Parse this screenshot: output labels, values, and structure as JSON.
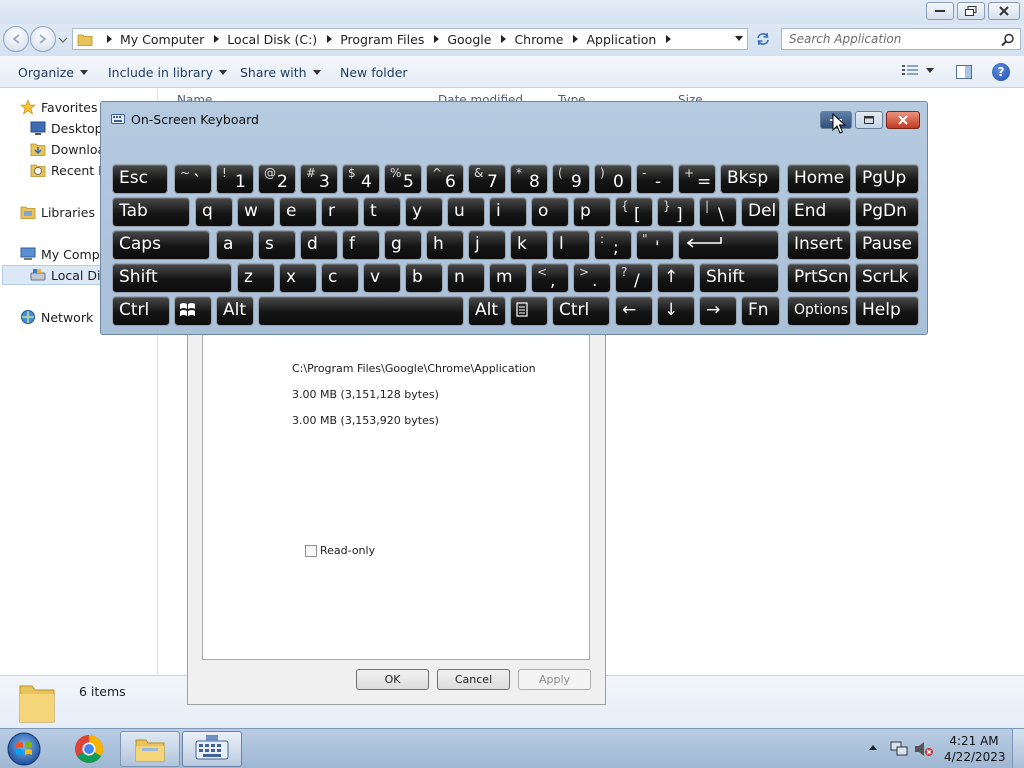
{
  "explorer": {
    "breadcrumb": [
      "My Computer",
      "Local Disk (C:)",
      "Program Files",
      "Google",
      "Chrome",
      "Application"
    ],
    "search_placeholder": "Search Application",
    "toolbar": {
      "organize": "Organize",
      "include": "Include in library",
      "share": "Share with",
      "new_folder": "New folder"
    },
    "nav": {
      "favorites": "Favorites",
      "desktop": "Desktop",
      "downloads": "Downloads",
      "recent": "Recent Places",
      "libraries": "Libraries",
      "computer": "My Computer",
      "local_disk": "Local Disk (C:)",
      "network": "Network"
    },
    "columns": [
      "Name",
      "Date modified",
      "Type",
      "Size"
    ],
    "details": "6 items"
  },
  "properties": {
    "location": "C:\\Program Files\\Google\\Chrome\\Application",
    "size": "3.00 MB (3,151,128 bytes)",
    "size_on_disk": "3.00 MB (3,153,920 bytes)",
    "readonly_label": "Read-only",
    "buttons": {
      "ok": "OK",
      "cancel": "Cancel",
      "apply": "Apply"
    }
  },
  "osk": {
    "title": "On-Screen Keyboard",
    "rows": [
      [
        {
          "id": "esc",
          "label": "Esc"
        },
        {
          "id": "tilde",
          "top": "~",
          "bottom": "`"
        },
        {
          "id": "1",
          "top": "!",
          "bottom": "1"
        },
        {
          "id": "2",
          "top": "@",
          "bottom": "2"
        },
        {
          "id": "3",
          "top": "#",
          "bottom": "3"
        },
        {
          "id": "4",
          "top": "$",
          "bottom": "4"
        },
        {
          "id": "5",
          "top": "%",
          "bottom": "5"
        },
        {
          "id": "6",
          "top": "^",
          "bottom": "6"
        },
        {
          "id": "7",
          "top": "&",
          "bottom": "7"
        },
        {
          "id": "8",
          "top": "*",
          "bottom": "8"
        },
        {
          "id": "9",
          "top": "(",
          "bottom": "9"
        },
        {
          "id": "0",
          "top": ")",
          "bottom": "0"
        },
        {
          "id": "minus",
          "top": "-",
          "bottom": "-"
        },
        {
          "id": "equals",
          "top": "+",
          "bottom": "="
        },
        {
          "id": "bksp",
          "label": "Bksp"
        },
        {
          "id": "home",
          "label": "Home"
        },
        {
          "id": "pgup",
          "label": "PgUp"
        }
      ],
      [
        {
          "id": "tab",
          "label": "Tab"
        },
        {
          "id": "q",
          "label": "q"
        },
        {
          "id": "w",
          "label": "w"
        },
        {
          "id": "e",
          "label": "e"
        },
        {
          "id": "r",
          "label": "r"
        },
        {
          "id": "t",
          "label": "t"
        },
        {
          "id": "y",
          "label": "y"
        },
        {
          "id": "u",
          "label": "u"
        },
        {
          "id": "i",
          "label": "i"
        },
        {
          "id": "o",
          "label": "o"
        },
        {
          "id": "p",
          "label": "p"
        },
        {
          "id": "lbracket",
          "top": "{",
          "bottom": "["
        },
        {
          "id": "rbracket",
          "top": "}",
          "bottom": "]"
        },
        {
          "id": "backslash",
          "top": "|",
          "bottom": "\\"
        },
        {
          "id": "del",
          "label": "Del"
        },
        {
          "id": "end",
          "label": "End"
        },
        {
          "id": "pgdn",
          "label": "PgDn"
        }
      ],
      [
        {
          "id": "caps",
          "label": "Caps"
        },
        {
          "id": "a",
          "label": "a"
        },
        {
          "id": "s",
          "label": "s"
        },
        {
          "id": "d",
          "label": "d"
        },
        {
          "id": "f",
          "label": "f"
        },
        {
          "id": "g",
          "label": "g"
        },
        {
          "id": "h",
          "label": "h"
        },
        {
          "id": "j",
          "label": "j"
        },
        {
          "id": "k",
          "label": "k"
        },
        {
          "id": "l",
          "label": "l"
        },
        {
          "id": "semicolon",
          "top": ":",
          "bottom": ";"
        },
        {
          "id": "quote",
          "top": "\"",
          "bottom": "'"
        },
        {
          "id": "enter",
          "icon": "enter-arrow-icon"
        },
        {
          "id": "insert",
          "label": "Insert"
        },
        {
          "id": "pause",
          "label": "Pause"
        }
      ],
      [
        {
          "id": "lshift",
          "label": "Shift"
        },
        {
          "id": "z",
          "label": "z"
        },
        {
          "id": "x",
          "label": "x"
        },
        {
          "id": "c",
          "label": "c"
        },
        {
          "id": "v",
          "label": "v"
        },
        {
          "id": "b",
          "label": "b"
        },
        {
          "id": "n",
          "label": "n"
        },
        {
          "id": "m",
          "label": "m"
        },
        {
          "id": "comma",
          "top": "<",
          "bottom": ","
        },
        {
          "id": "period",
          "top": ">",
          "bottom": "."
        },
        {
          "id": "slash",
          "top": "?",
          "bottom": "/"
        },
        {
          "id": "up",
          "label": "↑"
        },
        {
          "id": "rshift",
          "label": "Shift"
        },
        {
          "id": "prtscn",
          "label": "PrtScn"
        },
        {
          "id": "scrlk",
          "label": "ScrLk"
        }
      ],
      [
        {
          "id": "lctrl",
          "label": "Ctrl"
        },
        {
          "id": "win",
          "icon": "windows-logo-icon"
        },
        {
          "id": "lalt",
          "label": "Alt"
        },
        {
          "id": "space",
          "label": ""
        },
        {
          "id": "ralt",
          "label": "Alt"
        },
        {
          "id": "menu",
          "icon": "menu-icon"
        },
        {
          "id": "rctrl",
          "label": "Ctrl"
        },
        {
          "id": "left",
          "label": "←"
        },
        {
          "id": "down",
          "label": "↓"
        },
        {
          "id": "right",
          "label": "→"
        },
        {
          "id": "fn",
          "label": "Fn"
        },
        {
          "id": "options",
          "label": "Options"
        },
        {
          "id": "help",
          "label": "Help"
        }
      ]
    ]
  },
  "taskbar": {
    "time": "4:21 AM",
    "date": "4/22/2023"
  }
}
